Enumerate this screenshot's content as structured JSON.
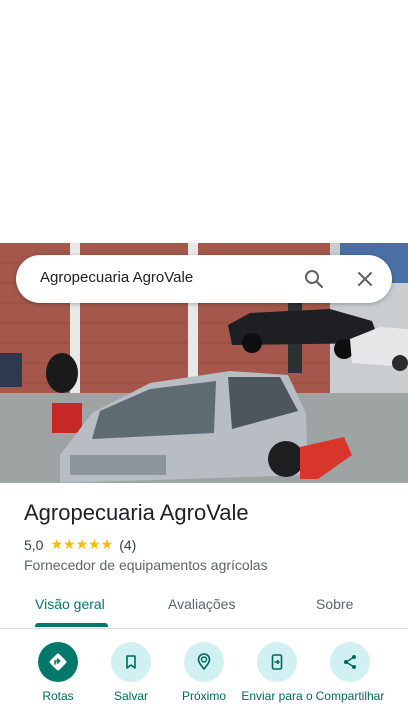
{
  "search": {
    "query": "Agropecuaria AgroVale"
  },
  "place": {
    "name": "Agropecuaria AgroVale",
    "rating": "5,0",
    "stars": "★★★★★",
    "review_count": "(4)",
    "category": "Fornecedor de equipamentos agrícolas"
  },
  "tabs": [
    "Visão geral",
    "Avaliações",
    "Sobre"
  ],
  "actions": [
    {
      "label": "Rotas",
      "icon": "directions-icon"
    },
    {
      "label": "Salvar",
      "icon": "bookmark-icon"
    },
    {
      "label": "Próximo",
      "icon": "nearby-icon"
    },
    {
      "label": "Enviar para o",
      "icon": "send-to-phone-icon"
    },
    {
      "label": "Compartilhar",
      "icon": "share-icon"
    }
  ],
  "colors": {
    "accent": "#00796b",
    "action_bg": "#d1f0f2",
    "star": "#fbbc04"
  }
}
